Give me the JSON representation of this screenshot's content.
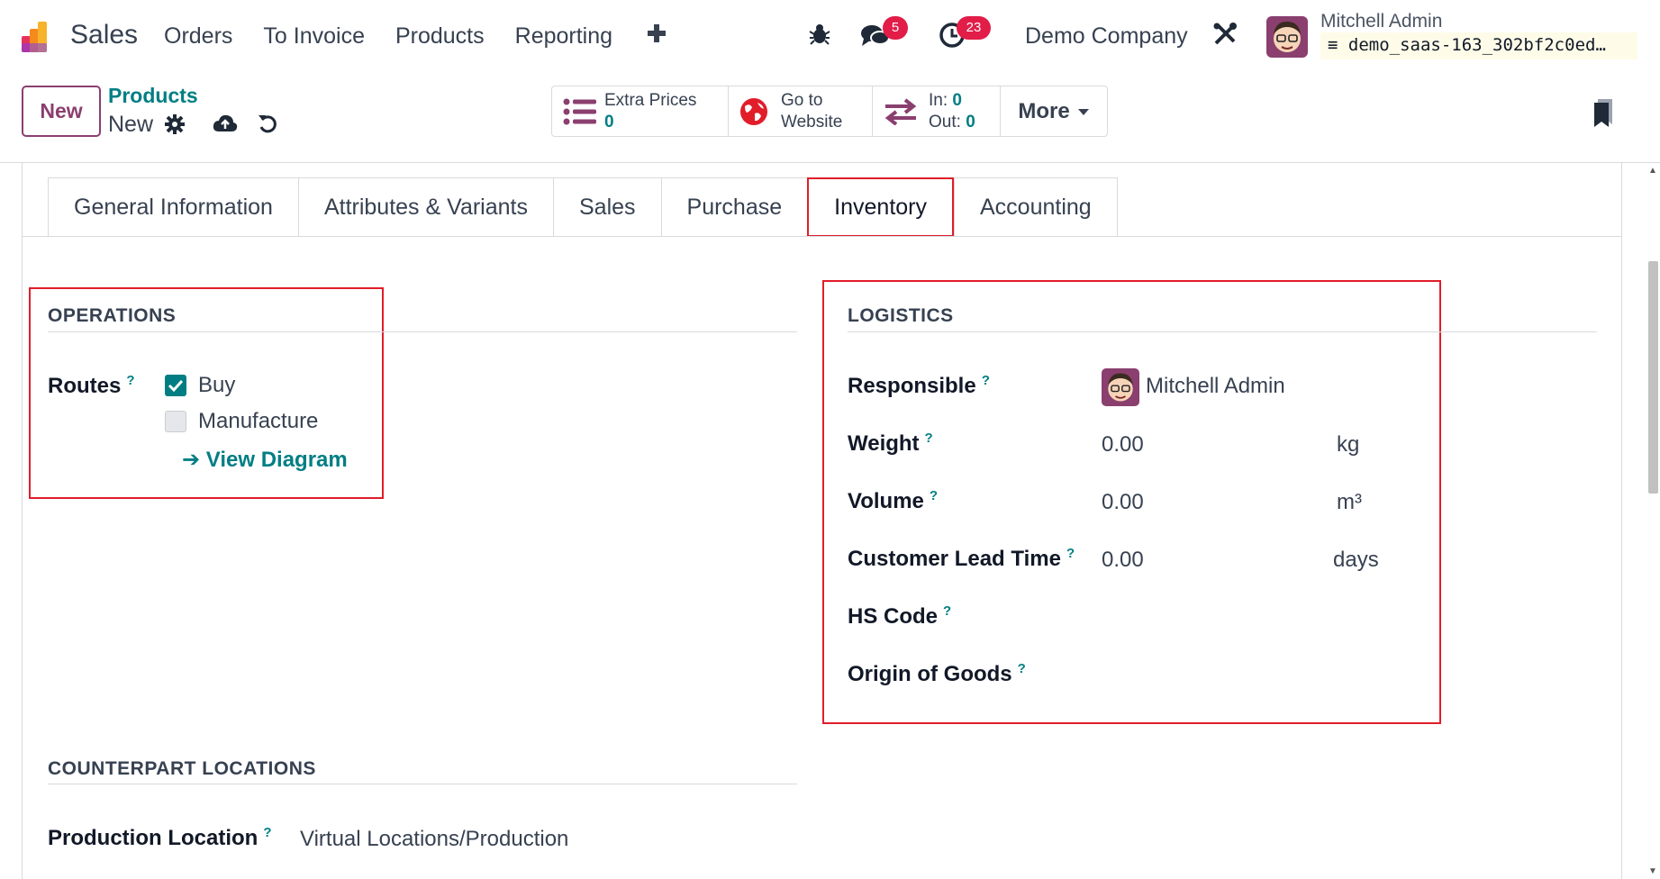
{
  "navbar": {
    "app_name": "Sales",
    "menu": [
      "Orders",
      "To Invoice",
      "Products",
      "Reporting"
    ],
    "messages_badge": "5",
    "activities_badge": "23",
    "company": "Demo Company",
    "user_name": "Mitchell Admin",
    "database": "demo_saas-163_302bf2c0ed…"
  },
  "control_panel": {
    "new_button": "New",
    "breadcrumb_parent": "Products",
    "breadcrumb_current": "New",
    "stats": {
      "extra_prices_label": "Extra Prices",
      "extra_prices_value": "0",
      "website_line1": "Go to",
      "website_line2": "Website",
      "in_label": "In:",
      "in_value": "0",
      "out_label": "Out:",
      "out_value": "0",
      "more_label": "More"
    }
  },
  "tabs": [
    "General Information",
    "Attributes & Variants",
    "Sales",
    "Purchase",
    "Inventory",
    "Accounting"
  ],
  "active_tab": "Inventory",
  "operations": {
    "title": "OPERATIONS",
    "routes_label": "Routes",
    "routes": [
      {
        "label": "Buy",
        "checked": true
      },
      {
        "label": "Manufacture",
        "checked": false
      }
    ],
    "view_diagram": "View Diagram"
  },
  "logistics": {
    "title": "LOGISTICS",
    "responsible_label": "Responsible",
    "responsible_value": "Mitchell Admin",
    "weight_label": "Weight",
    "weight_value": "0.00",
    "weight_unit": "kg",
    "volume_label": "Volume",
    "volume_value": "0.00",
    "volume_unit": "m³",
    "lead_time_label": "Customer Lead Time",
    "lead_time_value": "0.00",
    "lead_time_unit": "days",
    "hs_code_label": "HS Code",
    "origin_label": "Origin of Goods"
  },
  "counterpart": {
    "title": "COUNTERPART LOCATIONS",
    "production_label": "Production Location",
    "production_value": "Virtual Locations/Production"
  },
  "help_mark": "?",
  "colors": {
    "brand": "#8a3f6f",
    "accent": "#017e84",
    "highlight": "#e11d2a",
    "badge": "#e11d48"
  }
}
